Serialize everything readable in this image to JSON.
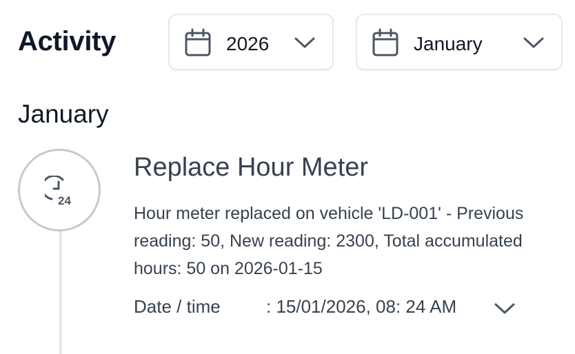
{
  "header": {
    "title": "Activity",
    "year_select": {
      "value": "2026",
      "icon": "calendar-icon"
    },
    "month_select": {
      "value": "January",
      "icon": "calendar-icon"
    }
  },
  "month_heading": "January",
  "entries": [
    {
      "icon": "clock-24-icon",
      "title": "Replace Hour Meter",
      "description": "Hour meter replaced on vehicle 'LD-001' - Previous reading: 50, New reading: 2300, Total accumulated hours: 50 on 2026-01-15",
      "datetime_label": "Date / time",
      "datetime_value": ": 15/01/2026, 08: 24 AM"
    }
  ],
  "colors": {
    "text_dark": "#111827",
    "text_body": "#374151",
    "border": "#e5e7eb",
    "node_border": "#c9c9c9",
    "icon": "#4b5563"
  }
}
